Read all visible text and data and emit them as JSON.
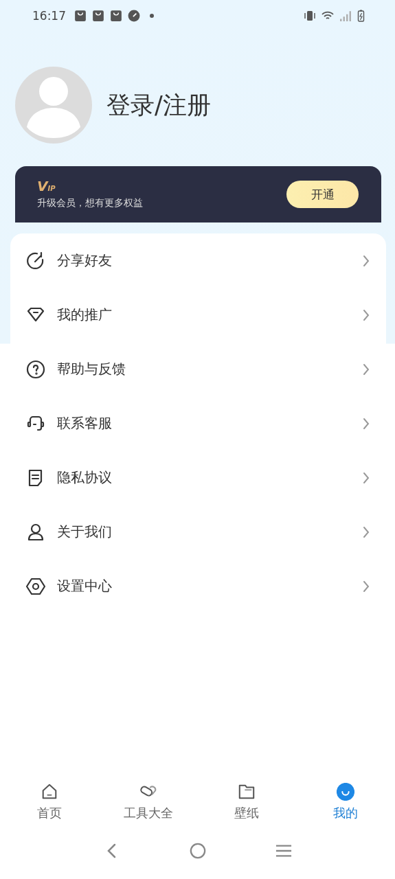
{
  "status_bar": {
    "time": "16:17"
  },
  "profile": {
    "login_text": "登录/注册"
  },
  "vip_banner": {
    "badge": "VIP",
    "subtitle": "升级会员，想有更多权益",
    "button": "开通"
  },
  "menu": [
    {
      "kind": "share",
      "label": "分享好友"
    },
    {
      "kind": "diamond",
      "label": "我的推广"
    },
    {
      "kind": "help",
      "label": "帮助与反馈"
    },
    {
      "kind": "headset",
      "label": "联系客服"
    },
    {
      "kind": "document",
      "label": "隐私协议"
    },
    {
      "kind": "person",
      "label": "关于我们"
    },
    {
      "kind": "settings",
      "label": "设置中心"
    }
  ],
  "tabs": [
    {
      "kind": "home",
      "label": "首页",
      "selected": false
    },
    {
      "kind": "tools",
      "label": "工具大全",
      "selected": false
    },
    {
      "kind": "folder",
      "label": "壁纸",
      "selected": false
    },
    {
      "kind": "me",
      "label": "我的",
      "selected": true
    }
  ]
}
